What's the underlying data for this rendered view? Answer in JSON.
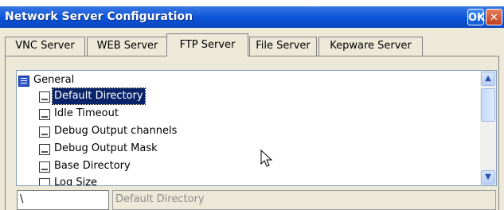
{
  "window": {
    "title": "Network Server Configuration",
    "ok_label": "OK",
    "close_label": "✕"
  },
  "tabs": [
    {
      "label": "VNC Server"
    },
    {
      "label": "WEB Server"
    },
    {
      "label": "FTP Server",
      "active": true
    },
    {
      "label": "File Server"
    },
    {
      "label": "Kepware Server"
    }
  ],
  "tree": {
    "root": "General",
    "items": [
      {
        "label": "Default Directory",
        "selected": true
      },
      {
        "label": "Idle Timeout"
      },
      {
        "label": "Debug Output channels"
      },
      {
        "label": "Debug Output Mask"
      },
      {
        "label": "Base Directory"
      },
      {
        "label": "Log Size"
      }
    ]
  },
  "footer": {
    "path_value": "\\",
    "name_value": "Default Directory"
  },
  "colors": {
    "titlebar": "#0a53d6",
    "selection": "#0a246a"
  },
  "icons": {
    "tree_root": "list-node-icon",
    "tree_item": "setting-node-icon",
    "scroll_up": "chevron-up-icon",
    "scroll_down": "chevron-down-icon",
    "cursor": "mouse-pointer-icon"
  }
}
